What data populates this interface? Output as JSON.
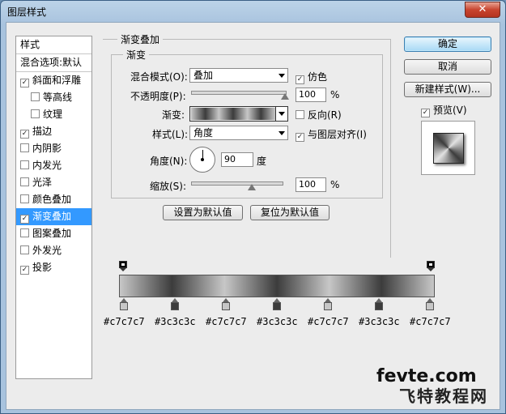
{
  "window": {
    "title": "图层样式",
    "close_label": "✕"
  },
  "sidebar": {
    "header": "样式",
    "blend_options": "混合选项:默认",
    "items": [
      {
        "label": "斜面和浮雕",
        "checked": true,
        "indent": false,
        "selected": false
      },
      {
        "label": "等高线",
        "checked": false,
        "indent": true,
        "selected": false
      },
      {
        "label": "纹理",
        "checked": false,
        "indent": true,
        "selected": false
      },
      {
        "label": "描边",
        "checked": true,
        "indent": false,
        "selected": false
      },
      {
        "label": "内阴影",
        "checked": false,
        "indent": false,
        "selected": false
      },
      {
        "label": "内发光",
        "checked": false,
        "indent": false,
        "selected": false
      },
      {
        "label": "光泽",
        "checked": false,
        "indent": false,
        "selected": false
      },
      {
        "label": "颜色叠加",
        "checked": false,
        "indent": false,
        "selected": false
      },
      {
        "label": "渐变叠加",
        "checked": true,
        "indent": false,
        "selected": true
      },
      {
        "label": "图案叠加",
        "checked": false,
        "indent": false,
        "selected": false
      },
      {
        "label": "外发光",
        "checked": false,
        "indent": false,
        "selected": false
      },
      {
        "label": "投影",
        "checked": true,
        "indent": false,
        "selected": false
      }
    ]
  },
  "panel": {
    "outer_title": "渐变叠加",
    "inner_title": "渐变",
    "blend_mode_label": "混合模式(O):",
    "blend_mode_value": "叠加",
    "dither_label": "仿色",
    "dither_checked": true,
    "opacity_label": "不透明度(P):",
    "opacity_value": "100",
    "opacity_percent": 100,
    "percent_sign": "%",
    "gradient_label": "渐变:",
    "reverse_label": "反向(R)",
    "reverse_checked": false,
    "style_label": "样式(L):",
    "style_value": "角度",
    "align_label": "与图层对齐(I)",
    "align_checked": true,
    "angle_label": "角度(N):",
    "angle_value": "90",
    "angle_unit": "度",
    "scale_label": "缩放(S):",
    "scale_value": "100",
    "scale_percent": 100,
    "make_default": "设置为默认值",
    "reset_default": "复位为默认值"
  },
  "buttons": {
    "ok": "确定",
    "cancel": "取消",
    "new_style": "新建样式(W)...",
    "preview_label": "预览(V)",
    "preview_checked": true
  },
  "gradient_stops": [
    {
      "color": "#c7c7c7",
      "label": "#c7c7c7"
    },
    {
      "color": "#3c3c3c",
      "label": "#3c3c3c"
    },
    {
      "color": "#c7c7c7",
      "label": "#c7c7c7"
    },
    {
      "color": "#3c3c3c",
      "label": "#3c3c3c"
    },
    {
      "color": "#c7c7c7",
      "label": "#c7c7c7"
    },
    {
      "color": "#3c3c3c",
      "label": "#3c3c3c"
    },
    {
      "color": "#c7c7c7",
      "label": "#c7c7c7"
    }
  ],
  "watermark": {
    "line1": "fevte.com",
    "line2": "飞特教程网"
  }
}
